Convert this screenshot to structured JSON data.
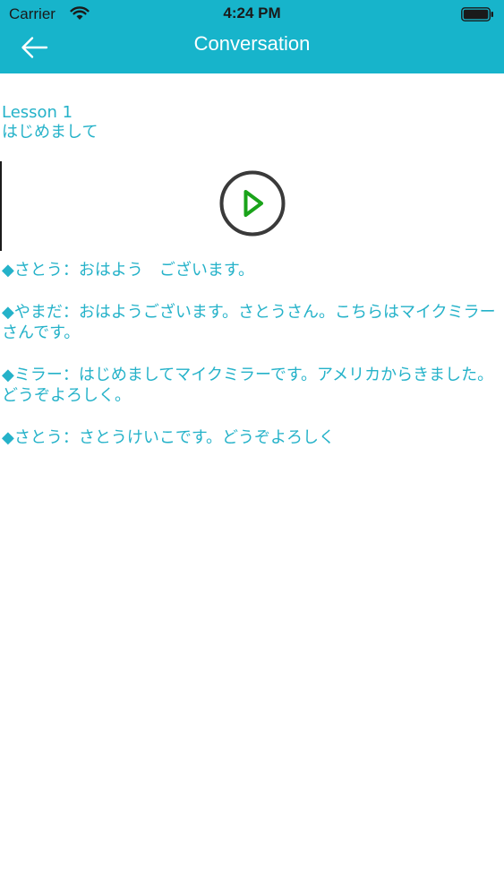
{
  "status_bar": {
    "carrier": "Carrier",
    "time": "4:24 PM",
    "wifi_icon": "wifi-icon",
    "battery_icon": "battery-icon"
  },
  "nav": {
    "title": "Conversation",
    "back_icon": "back-arrow-icon"
  },
  "lesson": {
    "number": "Lesson 1",
    "title": "はじめまして"
  },
  "player": {
    "play_icon": "play-icon",
    "ring_color": "#3a3a3a",
    "play_color": "#1aa31a"
  },
  "dialogue": [
    "◆さとう：おはよう　ございます。",
    "◆やまだ：おはようございます。さとうさん。こちらはマイクミラーさんです。",
    "◆ミラー：はじめましてマイクミラーです。アメリカからきました。どうぞよろしく。",
    "◆さとう：さとうけいこです。どうぞよろしく"
  ],
  "colors": {
    "header_bg": "#17b4cb",
    "text_accent": "#25b2c9"
  }
}
